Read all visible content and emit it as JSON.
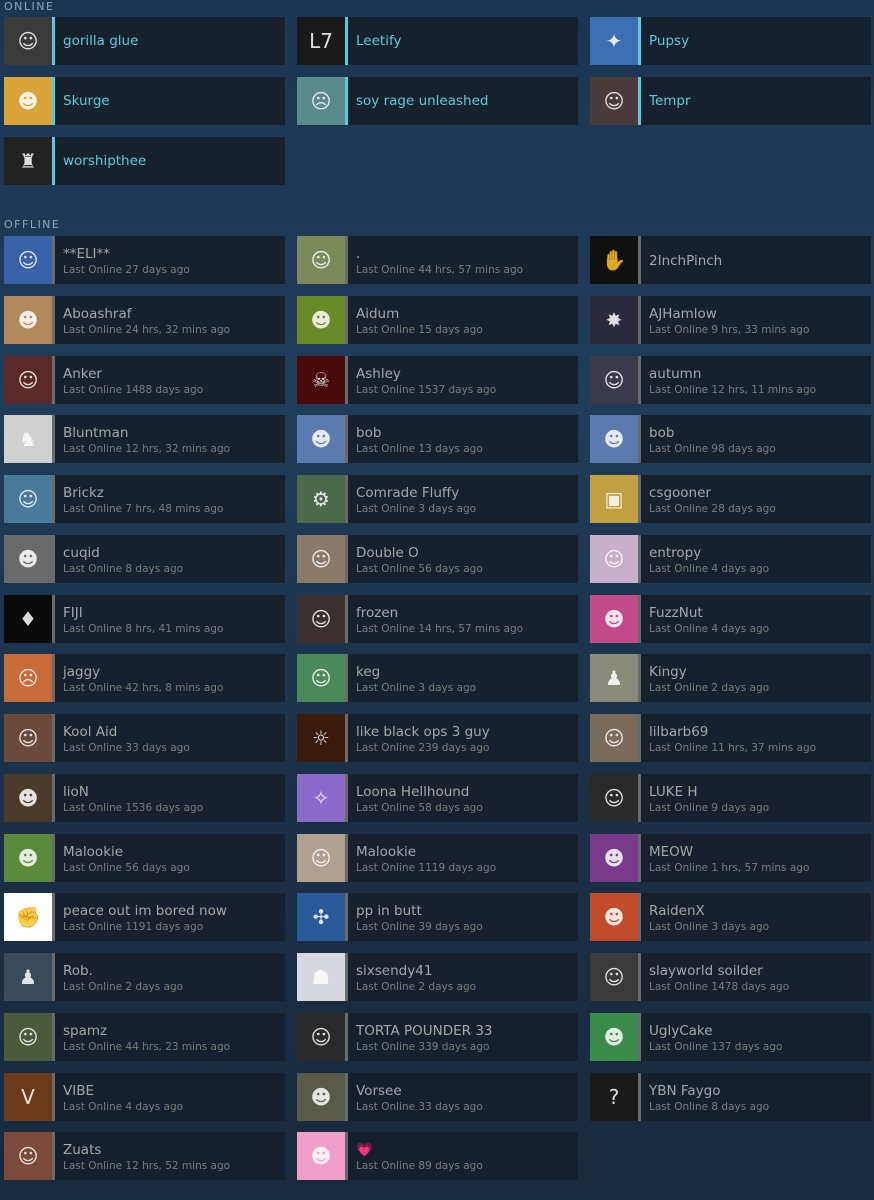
{
  "online_label": "ONLINE",
  "offline_label": "OFFLINE",
  "online": [
    {
      "name": "gorilla glue",
      "avatar_color": "#3a3a3a",
      "avatar_glyph": "☺"
    },
    {
      "name": "Leetify",
      "avatar_color": "#1a1a1a",
      "avatar_glyph": "L7"
    },
    {
      "name": "Pupsy",
      "avatar_color": "#3b6fb0",
      "avatar_glyph": "✦"
    },
    {
      "name": "Skurge",
      "avatar_color": "#d8a43a",
      "avatar_glyph": "☻"
    },
    {
      "name": "soy rage unleashed",
      "avatar_color": "#5a8a8c",
      "avatar_glyph": "☹"
    },
    {
      "name": "Tempr",
      "avatar_color": "#4a3a3a",
      "avatar_glyph": "☺"
    },
    {
      "name": "worshipthee",
      "avatar_color": "#222222",
      "avatar_glyph": "♜"
    }
  ],
  "offline": [
    {
      "name": "**ELI**",
      "last": "Last Online 27 days ago",
      "avatar_color": "#3a62a8",
      "avatar_glyph": "☺"
    },
    {
      "name": ".",
      "last": "Last Online 44 hrs, 57 mins ago",
      "avatar_color": "#7a8a5a",
      "avatar_glyph": "☺"
    },
    {
      "name": "2InchPinch",
      "last": "",
      "avatar_color": "#101010",
      "avatar_glyph": "✋"
    },
    {
      "name": "Aboashraf",
      "last": "Last Online 24 hrs, 32 mins ago",
      "avatar_color": "#b08a5a",
      "avatar_glyph": "☻"
    },
    {
      "name": "Aidum",
      "last": "Last Online 15 days ago",
      "avatar_color": "#6a8a2a",
      "avatar_glyph": "☻"
    },
    {
      "name": "AJHamlow",
      "last": "Last Online 9 hrs, 33 mins ago",
      "avatar_color": "#2a2a3a",
      "avatar_glyph": "✸"
    },
    {
      "name": "Anker",
      "last": "Last Online 1488 days ago",
      "avatar_color": "#5a2a2a",
      "avatar_glyph": "☺"
    },
    {
      "name": "Ashley",
      "last": "Last Online 1537 days ago",
      "avatar_color": "#4a0a0a",
      "avatar_glyph": "☠"
    },
    {
      "name": "autumn",
      "last": "Last Online 12 hrs, 11 mins ago",
      "avatar_color": "#3a3a4a",
      "avatar_glyph": "☺"
    },
    {
      "name": "Bluntman",
      "last": "Last Online 12 hrs, 32 mins ago",
      "avatar_color": "#d0d0d0",
      "avatar_glyph": "♞"
    },
    {
      "name": "bob",
      "last": "Last Online 13 days ago",
      "avatar_color": "#5a7ab0",
      "avatar_glyph": "☻"
    },
    {
      "name": "bob",
      "last": "Last Online 98 days ago",
      "avatar_color": "#5a7ab0",
      "avatar_glyph": "☻"
    },
    {
      "name": "Brickz",
      "last": "Last Online 7 hrs, 48 mins ago",
      "avatar_color": "#4a7a9a",
      "avatar_glyph": "☺"
    },
    {
      "name": "Comrade Fluffy",
      "last": "Last Online 3 days ago",
      "avatar_color": "#4a6a4a",
      "avatar_glyph": "⚙"
    },
    {
      "name": "csgooner",
      "last": "Last Online 28 days ago",
      "avatar_color": "#c0a040",
      "avatar_glyph": "▣"
    },
    {
      "name": "cuqid",
      "last": "Last Online 8 days ago",
      "avatar_color": "#6a6a6a",
      "avatar_glyph": "☻"
    },
    {
      "name": "Double O",
      "last": "Last Online 56 days ago",
      "avatar_color": "#8a7a6a",
      "avatar_glyph": "☺"
    },
    {
      "name": "entropy",
      "last": "Last Online 4 days ago",
      "avatar_color": "#c8b0c8",
      "avatar_glyph": "☺"
    },
    {
      "name": "FIJI",
      "last": "Last Online 8 hrs, 41 mins ago",
      "avatar_color": "#0a0a0a",
      "avatar_glyph": "♦"
    },
    {
      "name": "frozen",
      "last": "Last Online 14 hrs, 57 mins ago",
      "avatar_color": "#3a3030",
      "avatar_glyph": "☺"
    },
    {
      "name": "FuzzNut",
      "last": "Last Online 4 days ago",
      "avatar_color": "#c04a8a",
      "avatar_glyph": "☻"
    },
    {
      "name": "jaggy",
      "last": "Last Online 42 hrs, 8 mins ago",
      "avatar_color": "#c86a3a",
      "avatar_glyph": "☹"
    },
    {
      "name": "keg",
      "last": "Last Online 3 days ago",
      "avatar_color": "#4a8a5a",
      "avatar_glyph": "☺"
    },
    {
      "name": "Kingy",
      "last": "Last Online 2 days ago",
      "avatar_color": "#8a8a7a",
      "avatar_glyph": "♟"
    },
    {
      "name": "Kool Aid",
      "last": "Last Online 33 days ago",
      "avatar_color": "#6a4a3a",
      "avatar_glyph": "☺"
    },
    {
      "name": "like black ops 3 guy",
      "last": "Last Online 239 days ago",
      "avatar_color": "#3a1a0a",
      "avatar_glyph": "☼"
    },
    {
      "name": "lilbarb69",
      "last": "Last Online 11 hrs, 37 mins ago",
      "avatar_color": "#7a6a5a",
      "avatar_glyph": "☺"
    },
    {
      "name": "lioN",
      "last": "Last Online 1536 days ago",
      "avatar_color": "#4a3a2a",
      "avatar_glyph": "☻"
    },
    {
      "name": "Loona Hellhound",
      "last": "Last Online 58 days ago",
      "avatar_color": "#8a6ac8",
      "avatar_glyph": "✧"
    },
    {
      "name": "LUKE H",
      "last": "Last Online 9 days ago",
      "avatar_color": "#2a2a2a",
      "avatar_glyph": "☺"
    },
    {
      "name": "Malookie",
      "last": "Last Online 56 days ago",
      "avatar_color": "#5a8a3a",
      "avatar_glyph": "☻"
    },
    {
      "name": "Malookie",
      "last": "Last Online 1119 days ago",
      "avatar_color": "#b0a090",
      "avatar_glyph": "☺"
    },
    {
      "name": "MEOW",
      "last": "Last Online 1 hrs, 57 mins ago",
      "avatar_color": "#7a3a8a",
      "avatar_glyph": "☻"
    },
    {
      "name": "peace out im bored now",
      "last": "Last Online 1191 days ago",
      "avatar_color": "#ffffff",
      "avatar_glyph": "✊"
    },
    {
      "name": "pp in butt",
      "last": "Last Online 39 days ago",
      "avatar_color": "#2a5a9a",
      "avatar_glyph": "✣"
    },
    {
      "name": "RaidenX",
      "last": "Last Online 3 days ago",
      "avatar_color": "#c04a2a",
      "avatar_glyph": "☻"
    },
    {
      "name": "Rob.",
      "last": "Last Online 2 days ago",
      "avatar_color": "#3a4a5a",
      "avatar_glyph": "♟"
    },
    {
      "name": "sixsendy41",
      "last": "Last Online 2 days ago",
      "avatar_color": "#d8d8e0",
      "avatar_glyph": "☗"
    },
    {
      "name": "slayworld soilder",
      "last": "Last Online 1478 days ago",
      "avatar_color": "#3a3a3a",
      "avatar_glyph": "☺"
    },
    {
      "name": "spamz",
      "last": "Last Online 44 hrs, 23 mins ago",
      "avatar_color": "#4a5a3a",
      "avatar_glyph": "☺"
    },
    {
      "name": "TORTA POUNDER 33",
      "last": "Last Online 339 days ago",
      "avatar_color": "#2a2a2a",
      "avatar_glyph": "☺"
    },
    {
      "name": "UglyCake",
      "last": "Last Online 137 days ago",
      "avatar_color": "#3a8a4a",
      "avatar_glyph": "☻"
    },
    {
      "name": "VIBE",
      "last": "Last Online 4 days ago",
      "avatar_color": "#6a3a1a",
      "avatar_glyph": "V"
    },
    {
      "name": "Vorsee",
      "last": "Last Online 33 days ago",
      "avatar_color": "#5a5a4a",
      "avatar_glyph": "☻"
    },
    {
      "name": "YBN Faygo",
      "last": "Last Online 8 days ago",
      "avatar_color": "#1a1a1a",
      "avatar_glyph": "?"
    },
    {
      "name": "Zuats",
      "last": "Last Online 12 hrs, 52 mins ago",
      "avatar_color": "#7a4a3a",
      "avatar_glyph": "☺"
    },
    {
      "name": "💗",
      "last": "Last Online 89 days ago",
      "avatar_color": "#f0a0c8",
      "avatar_glyph": "☻"
    }
  ]
}
